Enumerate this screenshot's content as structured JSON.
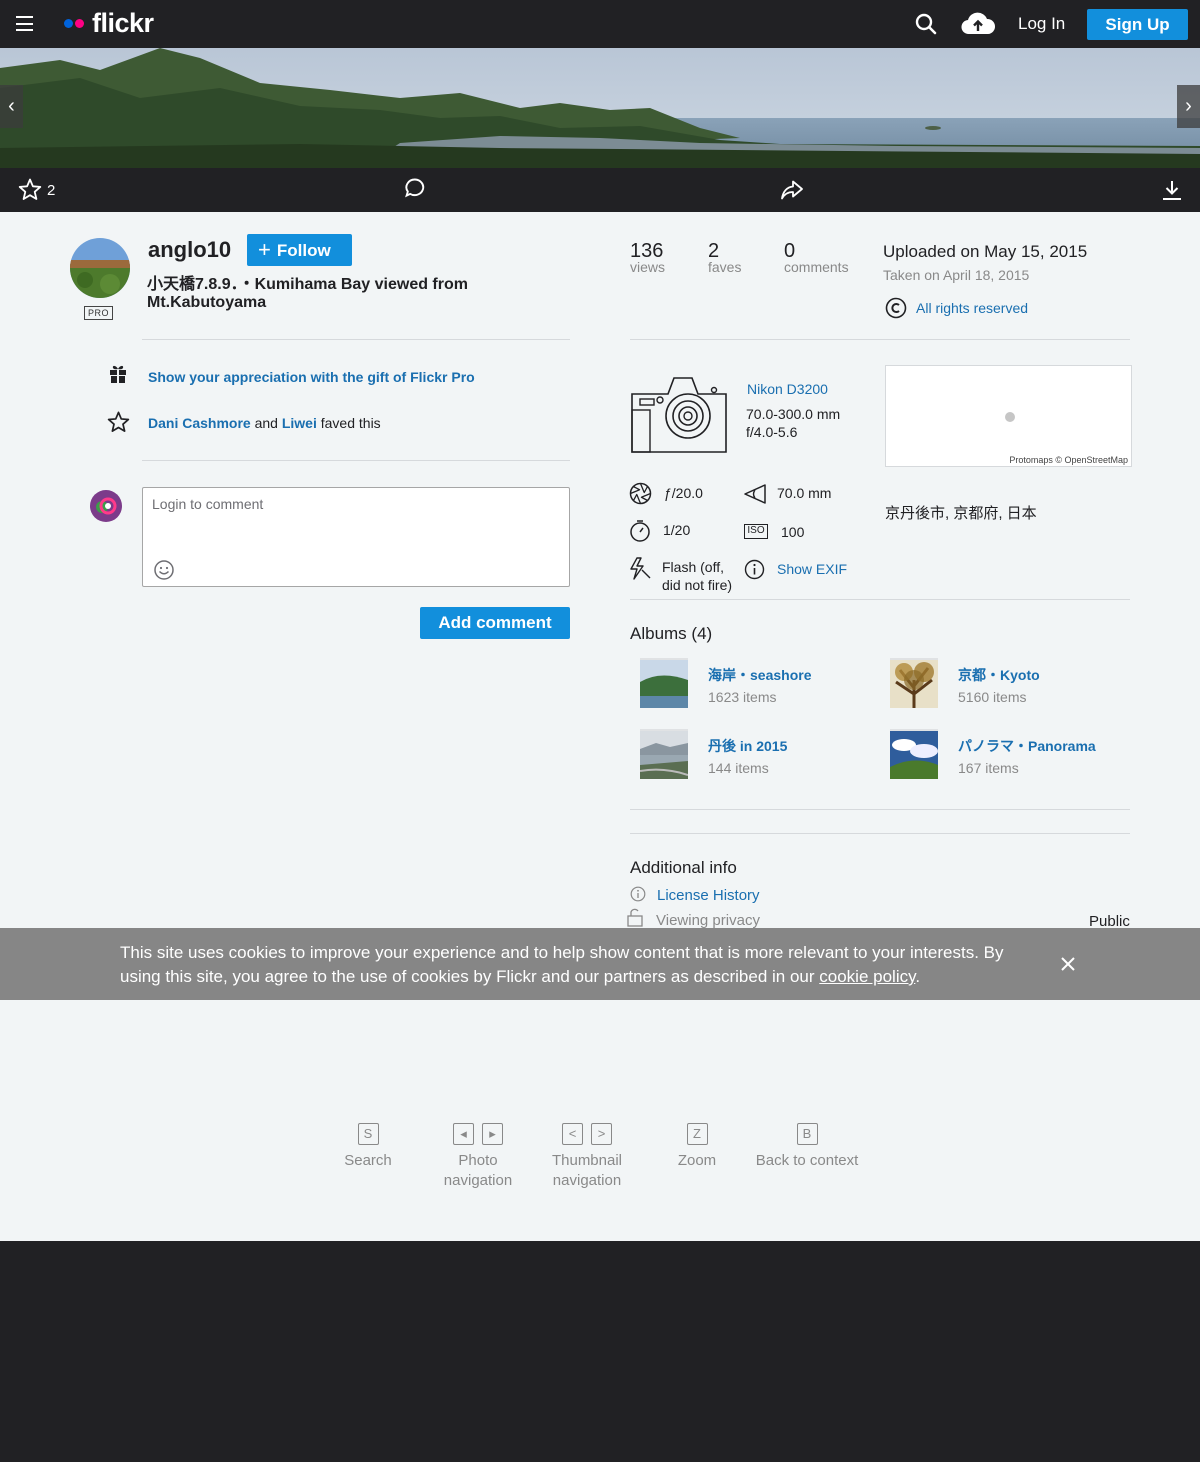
{
  "topbar": {
    "logo": "flickr",
    "login": "Log In",
    "signup": "Sign Up",
    "colors": {
      "logo_blue": "#0063dc",
      "logo_pink": "#ff0084",
      "accent": "#128fdc"
    }
  },
  "hero": {
    "prev": "‹",
    "next": "›"
  },
  "actions": {
    "fave_count": "2"
  },
  "owner": {
    "name": "anglo10",
    "pro": "PRO",
    "follow": "Follow"
  },
  "photo": {
    "title": "小天橋7.8.9．・Kumihama Bay viewed from Mt.Kabutoyama"
  },
  "gift": {
    "text": "Show your appreciation with the gift of Flickr Pro"
  },
  "faved": {
    "user1": "Dani Cashmore",
    "and": " and ",
    "user2": "Liwei",
    "suffix": " faved this"
  },
  "comment": {
    "placeholder": "Login to comment",
    "button": "Add comment"
  },
  "stats": [
    {
      "num": "136",
      "label": "views"
    },
    {
      "num": "2",
      "label": "faves"
    },
    {
      "num": "0",
      "label": "comments"
    }
  ],
  "dates": {
    "uploaded": "Uploaded on May 15, 2015",
    "taken": "Taken on April 18, 2015"
  },
  "license": {
    "text": "All rights reserved"
  },
  "camera": {
    "name": "Nikon D3200",
    "lens1": "70.0-300.0 mm",
    "lens2": "f/4.0-5.6"
  },
  "map": {
    "credit": "Protomaps © OpenStreetMap"
  },
  "location": "京丹後市, 京都府, 日本",
  "exif": {
    "aperture": "ƒ/20.0",
    "focal": "70.0 mm",
    "shutter": "1/20",
    "iso": "100",
    "iso_label": "ISO",
    "flash": "Flash (off, did not fire)",
    "show": "Show EXIF"
  },
  "albums": {
    "title": "Albums (4)",
    "items": [
      {
        "name": "海岸・seashore",
        "count": "1623 items"
      },
      {
        "name": "京都・Kyoto",
        "count": "5160 items"
      },
      {
        "name": "丹後 in 2015",
        "count": "144 items"
      },
      {
        "name": "パノラマ・Panorama",
        "count": "167 items"
      }
    ]
  },
  "additional": {
    "title": "Additional info",
    "license_history": "License History",
    "privacy_label": "Viewing privacy",
    "privacy_value": "Public"
  },
  "cookie": {
    "text": "This site uses cookies to improve your experience and to help show content that is more relevant to your interests. By using this site, you agree to the use of cookies by Flickr and our partners as described in our ",
    "link": "cookie policy",
    "end": "."
  },
  "shortcuts": [
    {
      "keys": [
        "S"
      ],
      "label": "Search"
    },
    {
      "keys": [
        "◂",
        "▸"
      ],
      "label": "Photo navigation"
    },
    {
      "keys": [
        "<",
        ">"
      ],
      "label": "Thumbnail navigation"
    },
    {
      "keys": [
        "Z"
      ],
      "label": "Zoom"
    },
    {
      "keys": [
        "B"
      ],
      "label": "Back to context"
    }
  ]
}
